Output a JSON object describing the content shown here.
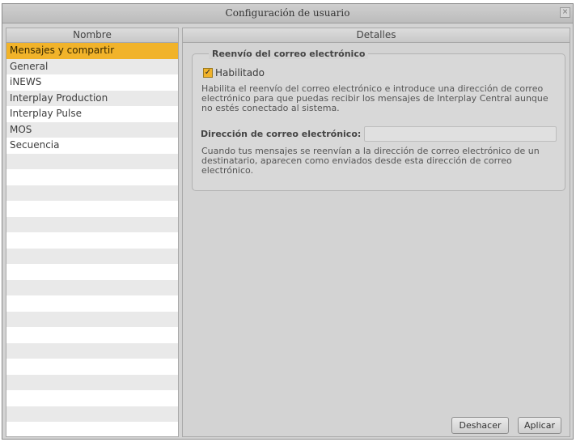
{
  "window": {
    "title": "Configuración de usuario",
    "close_glyph": "×"
  },
  "sidebar": {
    "header": "Nombre",
    "items": [
      {
        "label": "Mensajes y compartir",
        "selected": true
      },
      {
        "label": "General"
      },
      {
        "label": "iNEWS"
      },
      {
        "label": "Interplay Production"
      },
      {
        "label": "Interplay Pulse"
      },
      {
        "label": "MOS"
      },
      {
        "label": "Secuencia"
      },
      {
        "label": ""
      },
      {
        "label": ""
      },
      {
        "label": ""
      },
      {
        "label": ""
      },
      {
        "label": ""
      },
      {
        "label": ""
      },
      {
        "label": ""
      },
      {
        "label": ""
      },
      {
        "label": ""
      },
      {
        "label": ""
      },
      {
        "label": ""
      },
      {
        "label": ""
      },
      {
        "label": ""
      },
      {
        "label": ""
      },
      {
        "label": ""
      },
      {
        "label": ""
      },
      {
        "label": ""
      },
      {
        "label": ""
      }
    ]
  },
  "details": {
    "header": "Detalles",
    "group_title": "Reenvío del correo electrónico",
    "enabled_label": "Habilitado",
    "enabled_checked": true,
    "description": "Habilita el reenvío del correo electrónico e introduce una dirección de correo electrónico para que puedas recibir los mensajes de Interplay Central aunque no estés conectado al sistema.",
    "email_label": "Dirección de correo electrónico:",
    "email_value": "",
    "note": "Cuando tus mensajes se reenvían a la dirección de correo electrónico de un destinatario, aparecen como enviados desde esta dirección de correo electrónico."
  },
  "buttons": {
    "undo": "Deshacer",
    "apply": "Aplicar"
  },
  "colors": {
    "selection": "#f1b32a",
    "panel": "#d3d3d3"
  }
}
